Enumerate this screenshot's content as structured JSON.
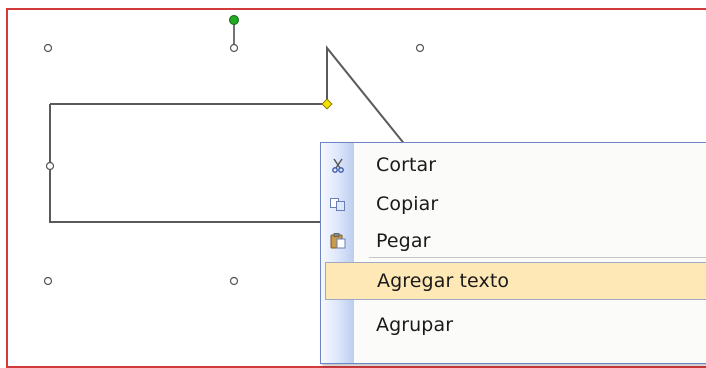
{
  "colors": {
    "slide_border": "#d23b3b",
    "menu_border": "#6f86c6",
    "menu_highlight": "#fde8b6",
    "rotation_handle": "#22aa22",
    "adjustment_handle": "#f2e200"
  },
  "context_menu": {
    "items": [
      {
        "label": "Cortar",
        "icon": "scissors-icon"
      },
      {
        "label": "Copiar",
        "icon": "copy-icon"
      },
      {
        "label": "Pegar",
        "icon": "paste-icon"
      },
      {
        "label": "Agregar texto",
        "icon": null,
        "highlighted": true
      },
      {
        "label": "Agrupar",
        "icon": null
      }
    ]
  }
}
